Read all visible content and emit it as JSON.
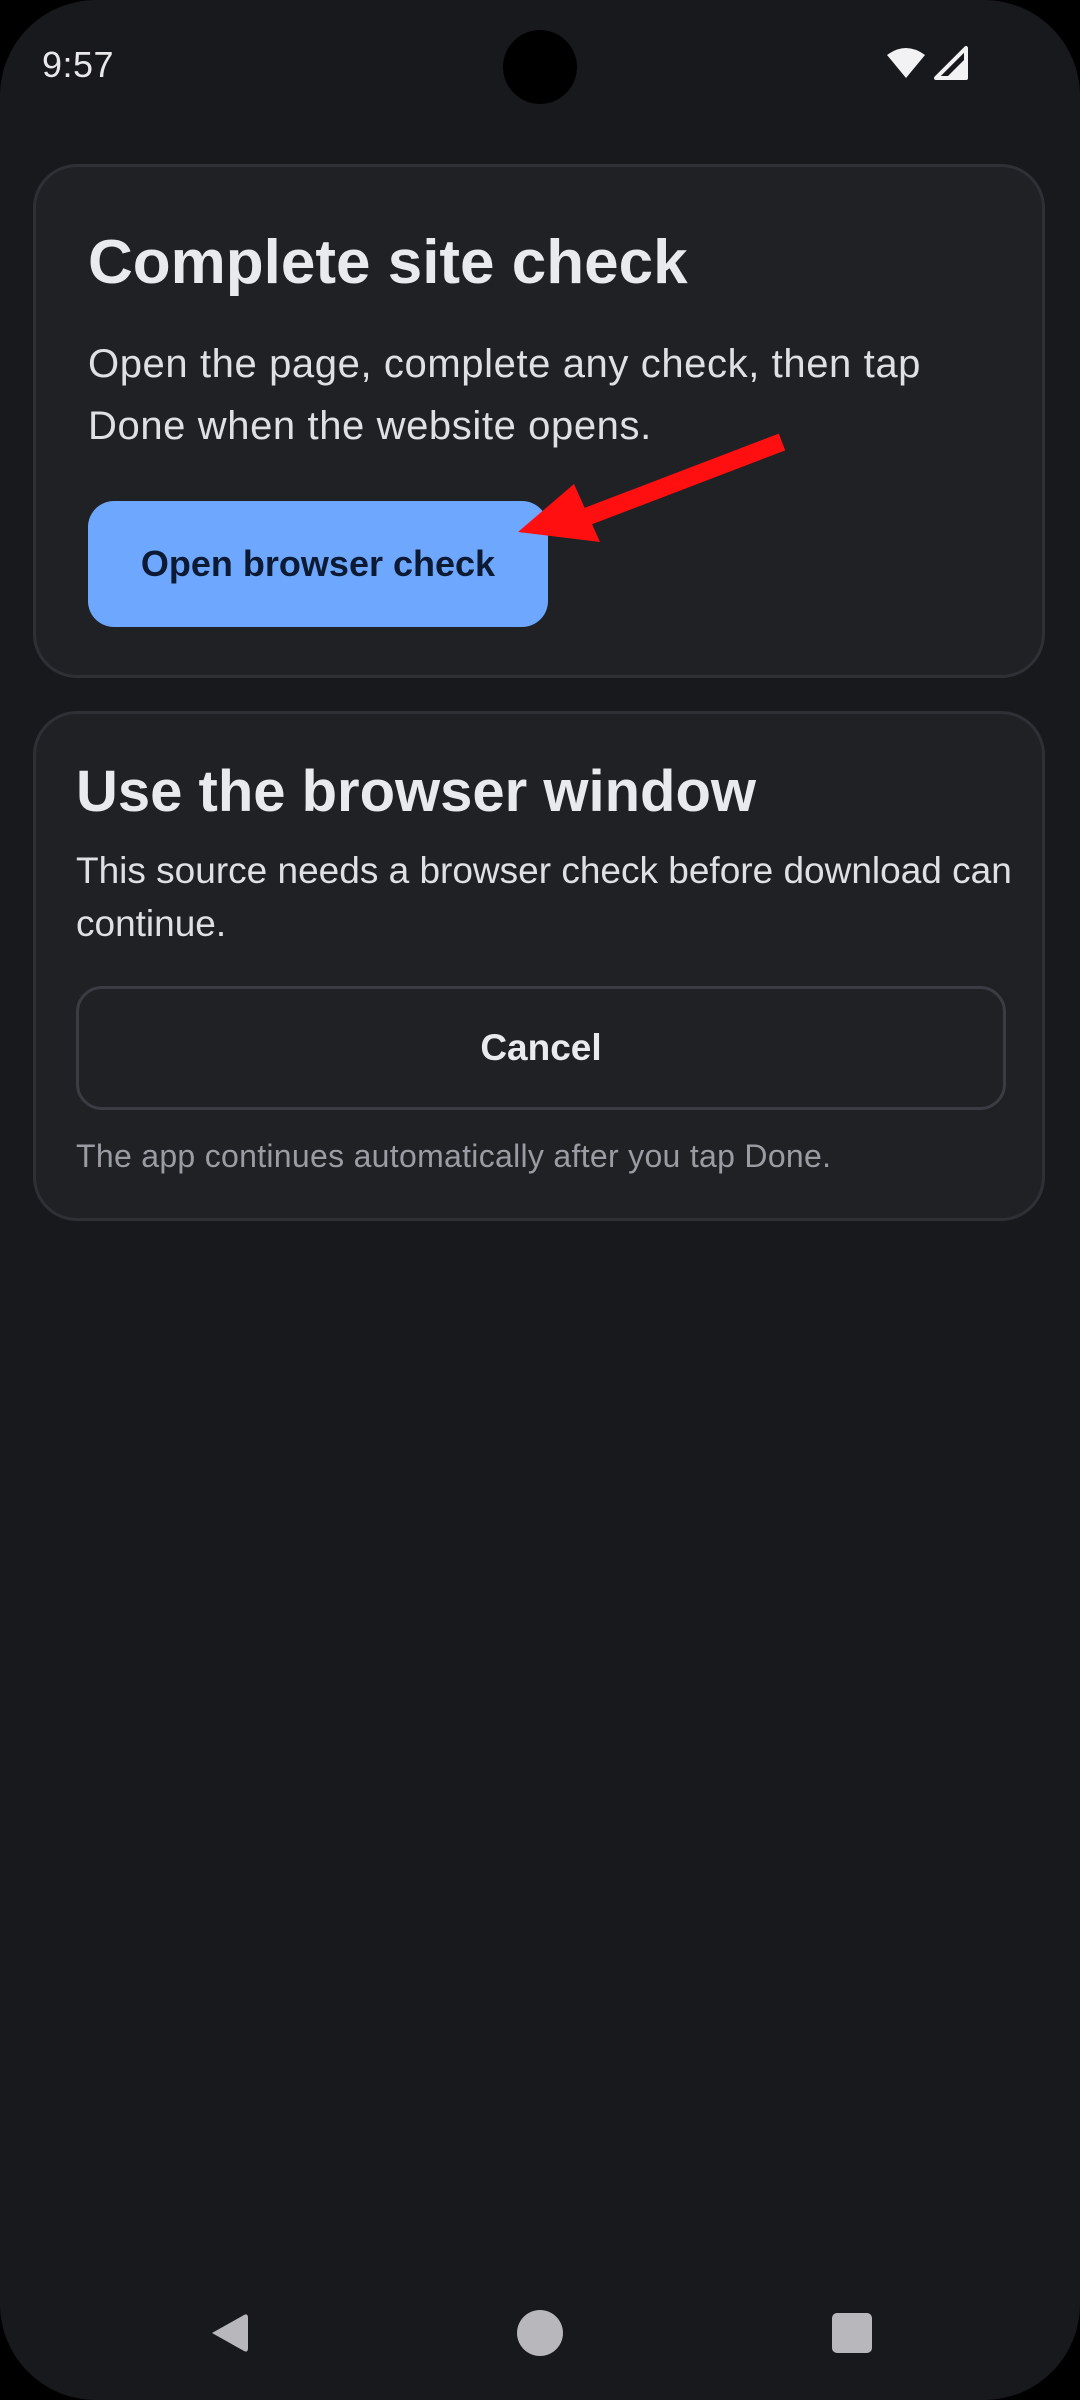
{
  "status_bar": {
    "time": "9:57",
    "icons": [
      "wifi-icon",
      "cellular-signal-icon"
    ]
  },
  "site_check_card": {
    "title": "Complete site check",
    "body": "Open the page, complete any check, then tap Done when the website opens.",
    "button_label": "Open browser check",
    "button_color": "#6ea8fe"
  },
  "browser_window_card": {
    "title": "Use the browser window",
    "body": "This source needs a browser check before download can continue.",
    "cancel_label": "Cancel",
    "helper": "The app continues automatically after you tap Done."
  },
  "annotation": {
    "icon": "red-arrow-icon",
    "color": "#ff0f0f"
  },
  "navigation_bar": {
    "icons": [
      "back-icon",
      "home-icon",
      "recents-icon"
    ]
  },
  "theme": {
    "background": "#18191d",
    "card_background": "#1f2125",
    "card_border": "#2e3036"
  }
}
